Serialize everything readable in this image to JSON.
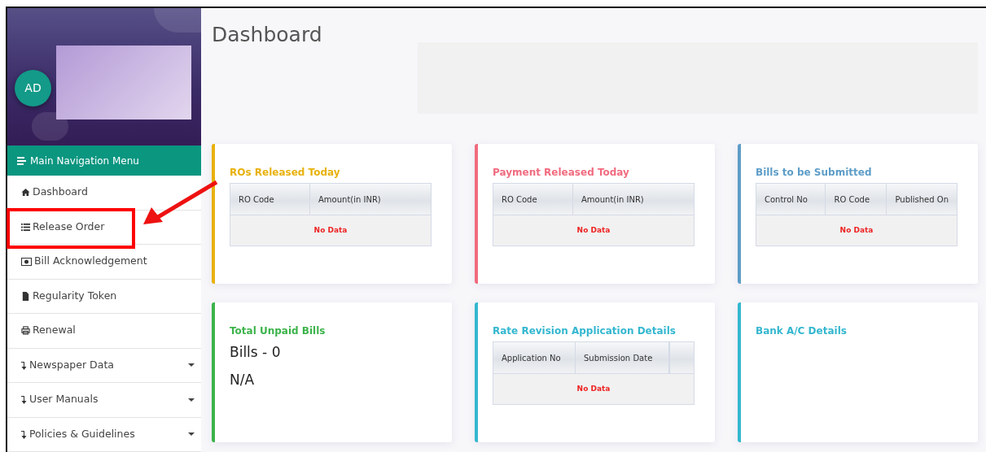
{
  "sidebar": {
    "avatar": "AD",
    "menu_title": "Main Navigation Menu",
    "items": [
      {
        "label": "Dashboard",
        "dropdown": false
      },
      {
        "label": "Release Order",
        "dropdown": false
      },
      {
        "label": "Bill Acknowledgement",
        "dropdown": false
      },
      {
        "label": "Regularity Token",
        "dropdown": false
      },
      {
        "label": "Renewal",
        "dropdown": false
      },
      {
        "label": "Newspaper Data",
        "dropdown": true
      },
      {
        "label": "User Manuals",
        "dropdown": true
      },
      {
        "label": "Policies & Guidelines",
        "dropdown": true
      }
    ]
  },
  "page_title": "Dashboard",
  "cards": [
    {
      "kind": "table",
      "title": "ROs Released Today",
      "color": "#e8b10d",
      "columns": [
        "RO Code",
        "Amount(in INR)"
      ],
      "empty": "No Data"
    },
    {
      "kind": "table",
      "title": "Payment Released Today",
      "color": "#f16b7f",
      "columns": [
        "RO Code",
        "Amount(in INR)"
      ],
      "empty": "No Data"
    },
    {
      "kind": "table",
      "title": "Bills to be Submitted",
      "color": "#5e9dc8",
      "columns": [
        "Control No",
        "RO Code",
        "Published On"
      ],
      "empty": "No Data"
    },
    {
      "kind": "stats",
      "title": "Total Unpaid Bills",
      "color": "#3cb34a",
      "lines": [
        "Bills - 0",
        "N/A"
      ]
    },
    {
      "kind": "table",
      "title": "Rate Revision Application Details",
      "color": "#34b7cf",
      "columns": [
        "Application No",
        "Submission Date"
      ],
      "blank_column": true,
      "empty": "No Data"
    },
    {
      "kind": "blank",
      "title": "Bank A/C Details",
      "color": "#34b7cf"
    }
  ]
}
